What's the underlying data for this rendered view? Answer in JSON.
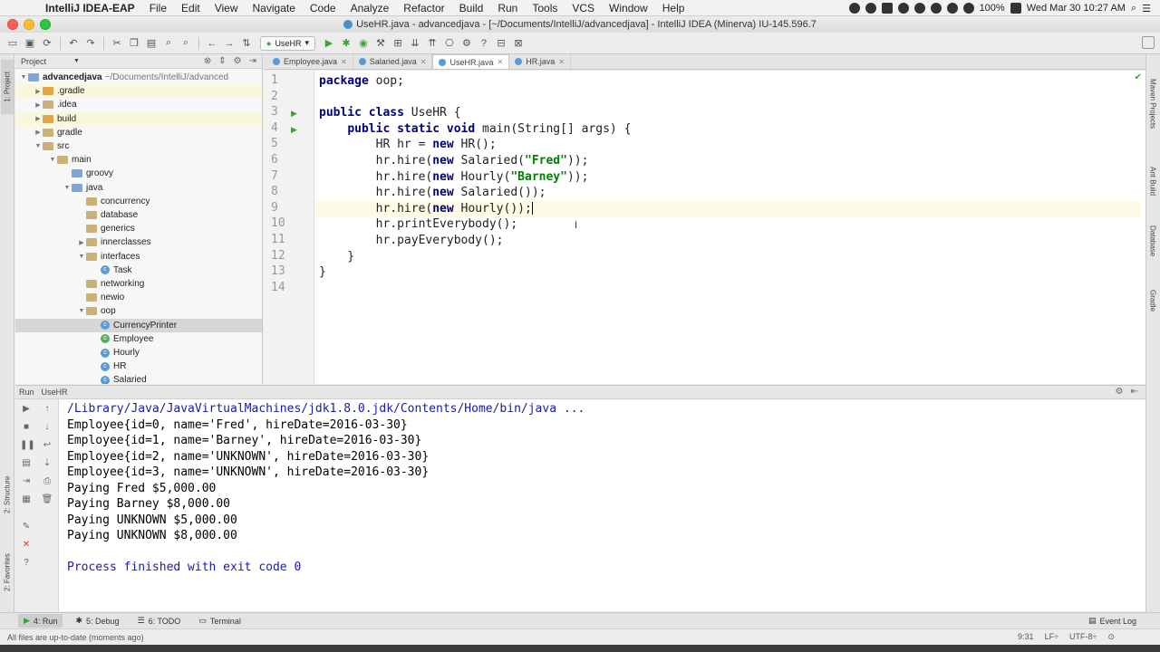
{
  "menubar": {
    "app_name": "IntelliJ IDEA-EAP",
    "items": [
      "File",
      "Edit",
      "View",
      "Navigate",
      "Code",
      "Analyze",
      "Refactor",
      "Build",
      "Run",
      "Tools",
      "VCS",
      "Window",
      "Help"
    ],
    "battery": "100%",
    "datetime": "Wed Mar 30  10:27 AM"
  },
  "window": {
    "title": "UseHR.java - advancedjava - [~/Documents/IntelliJ/advancedjava] - IntelliJ IDEA (Minerva) IU-145.596.7"
  },
  "toolbar": {
    "run_config": "UseHR"
  },
  "side_tabs": {
    "project": "1: Project",
    "structure": "2: Structure",
    "favorites": "2: Favorites",
    "maven": "Maven Projects",
    "ant": "Ant Build",
    "database": "Database",
    "gradle": "Gradle"
  },
  "project_panel": {
    "title": "Project",
    "tree": [
      {
        "label": "advancedjava",
        "path": "~/Documents/IntelliJ/advanced",
        "kind": "module",
        "depth": 0,
        "arrow": "▼"
      },
      {
        "label": ".gradle",
        "kind": "folder-orange",
        "depth": 1,
        "arrow": "▶",
        "highlight": true
      },
      {
        "label": ".idea",
        "kind": "folder-plain",
        "depth": 1,
        "arrow": "▶"
      },
      {
        "label": "build",
        "kind": "folder-orange",
        "depth": 1,
        "arrow": "▶",
        "highlight": true
      },
      {
        "label": "gradle",
        "kind": "folder-plain",
        "depth": 1,
        "arrow": "▶"
      },
      {
        "label": "src",
        "kind": "folder-plain",
        "depth": 1,
        "arrow": "▼"
      },
      {
        "label": "main",
        "kind": "folder-plain",
        "depth": 2,
        "arrow": "▼"
      },
      {
        "label": "groovy",
        "kind": "folder-blue",
        "depth": 3,
        "arrow": ""
      },
      {
        "label": "java",
        "kind": "folder-blue",
        "depth": 3,
        "arrow": "▼"
      },
      {
        "label": "concurrency",
        "kind": "folder-plain",
        "depth": 4,
        "arrow": ""
      },
      {
        "label": "database",
        "kind": "folder-plain",
        "depth": 4,
        "arrow": ""
      },
      {
        "label": "generics",
        "kind": "folder-plain",
        "depth": 4,
        "arrow": ""
      },
      {
        "label": "innerclasses",
        "kind": "folder-plain",
        "depth": 4,
        "arrow": "▶"
      },
      {
        "label": "interfaces",
        "kind": "folder-plain",
        "depth": 4,
        "arrow": "▼"
      },
      {
        "label": "Task",
        "kind": "class",
        "depth": 5,
        "arrow": ""
      },
      {
        "label": "networking",
        "kind": "folder-plain",
        "depth": 4,
        "arrow": ""
      },
      {
        "label": "newio",
        "kind": "folder-plain",
        "depth": 4,
        "arrow": ""
      },
      {
        "label": "oop",
        "kind": "folder-plain",
        "depth": 4,
        "arrow": "▼"
      },
      {
        "label": "CurrencyPrinter",
        "kind": "class",
        "depth": 5,
        "arrow": "",
        "selected": true
      },
      {
        "label": "Employee",
        "kind": "class-green",
        "depth": 5,
        "arrow": ""
      },
      {
        "label": "Hourly",
        "kind": "class",
        "depth": 5,
        "arrow": ""
      },
      {
        "label": "HR",
        "kind": "class",
        "depth": 5,
        "arrow": ""
      },
      {
        "label": "Salaried",
        "kind": "class",
        "depth": 5,
        "arrow": ""
      }
    ]
  },
  "editor": {
    "tabs": [
      {
        "label": "Employee.java",
        "active": false
      },
      {
        "label": "Salaried.java",
        "active": false
      },
      {
        "label": "UseHR.java",
        "active": true
      },
      {
        "label": "HR.java",
        "active": false
      }
    ],
    "line_numbers": [
      "1",
      "2",
      "3",
      "4",
      "5",
      "6",
      "7",
      "8",
      "9",
      "10",
      "11",
      "12",
      "13",
      "14"
    ],
    "run_marks_on_lines": [
      3,
      4
    ],
    "current_line": 9,
    "lines": [
      [
        {
          "t": "package ",
          "c": "kw"
        },
        {
          "t": "oop;",
          "c": ""
        }
      ],
      [],
      [
        {
          "t": "public class ",
          "c": "kw"
        },
        {
          "t": "UseHR {",
          "c": ""
        }
      ],
      [
        {
          "t": "    ",
          "c": ""
        },
        {
          "t": "public static void ",
          "c": "kw"
        },
        {
          "t": "main(String[] args) {",
          "c": ""
        }
      ],
      [
        {
          "t": "        HR hr = ",
          "c": ""
        },
        {
          "t": "new ",
          "c": "kw"
        },
        {
          "t": "HR();",
          "c": ""
        }
      ],
      [
        {
          "t": "        hr.hire(",
          "c": ""
        },
        {
          "t": "new ",
          "c": "kw"
        },
        {
          "t": "Salaried(",
          "c": ""
        },
        {
          "t": "\"Fred\"",
          "c": "str"
        },
        {
          "t": "));",
          "c": ""
        }
      ],
      [
        {
          "t": "        hr.hire(",
          "c": ""
        },
        {
          "t": "new ",
          "c": "kw"
        },
        {
          "t": "Hourly(",
          "c": ""
        },
        {
          "t": "\"Barney\"",
          "c": "str"
        },
        {
          "t": "));",
          "c": ""
        }
      ],
      [
        {
          "t": "        hr.hire(",
          "c": ""
        },
        {
          "t": "new ",
          "c": "kw"
        },
        {
          "t": "Salaried());",
          "c": ""
        }
      ],
      [
        {
          "t": "        hr.hire(",
          "c": ""
        },
        {
          "t": "new ",
          "c": "kw"
        },
        {
          "t": "Hourly());",
          "c": ""
        }
      ],
      [
        {
          "t": "        hr.printEverybody();",
          "c": ""
        }
      ],
      [
        {
          "t": "        hr.payEverybody();",
          "c": ""
        }
      ],
      [
        {
          "t": "    }",
          "c": ""
        }
      ],
      [
        {
          "t": "}",
          "c": ""
        }
      ],
      []
    ]
  },
  "run_panel": {
    "tab_label": "Run",
    "config_label": "UseHR",
    "output": [
      {
        "text": "/Library/Java/JavaVirtualMachines/jdk1.8.0.jdk/Contents/Home/bin/java ...",
        "kind": "cmd"
      },
      {
        "text": "Employee{id=0, name='Fred', hireDate=2016-03-30}",
        "kind": ""
      },
      {
        "text": "Employee{id=1, name='Barney', hireDate=2016-03-30}",
        "kind": ""
      },
      {
        "text": "Employee{id=2, name='UNKNOWN', hireDate=2016-03-30}",
        "kind": ""
      },
      {
        "text": "Employee{id=3, name='UNKNOWN', hireDate=2016-03-30}",
        "kind": ""
      },
      {
        "text": "Paying Fred $5,000.00",
        "kind": ""
      },
      {
        "text": "Paying Barney $8,000.00",
        "kind": ""
      },
      {
        "text": "Paying UNKNOWN $5,000.00",
        "kind": ""
      },
      {
        "text": "Paying UNKNOWN $8,000.00",
        "kind": ""
      },
      {
        "text": "",
        "kind": ""
      },
      {
        "text": "Process finished with exit code 0",
        "kind": "exit"
      }
    ]
  },
  "bottom_tabs": {
    "run": "4: Run",
    "debug": "5: Debug",
    "todo": "6: TODO",
    "terminal": "Terminal",
    "event_log": "Event Log"
  },
  "statusbar": {
    "message": "All files are up-to-date (moments ago)",
    "position": "9:31",
    "line_sep": "LF÷",
    "encoding": "UTF-8÷"
  },
  "colors": {
    "keyword": "#000080",
    "string": "#008000",
    "run_green": "#3aa236"
  }
}
